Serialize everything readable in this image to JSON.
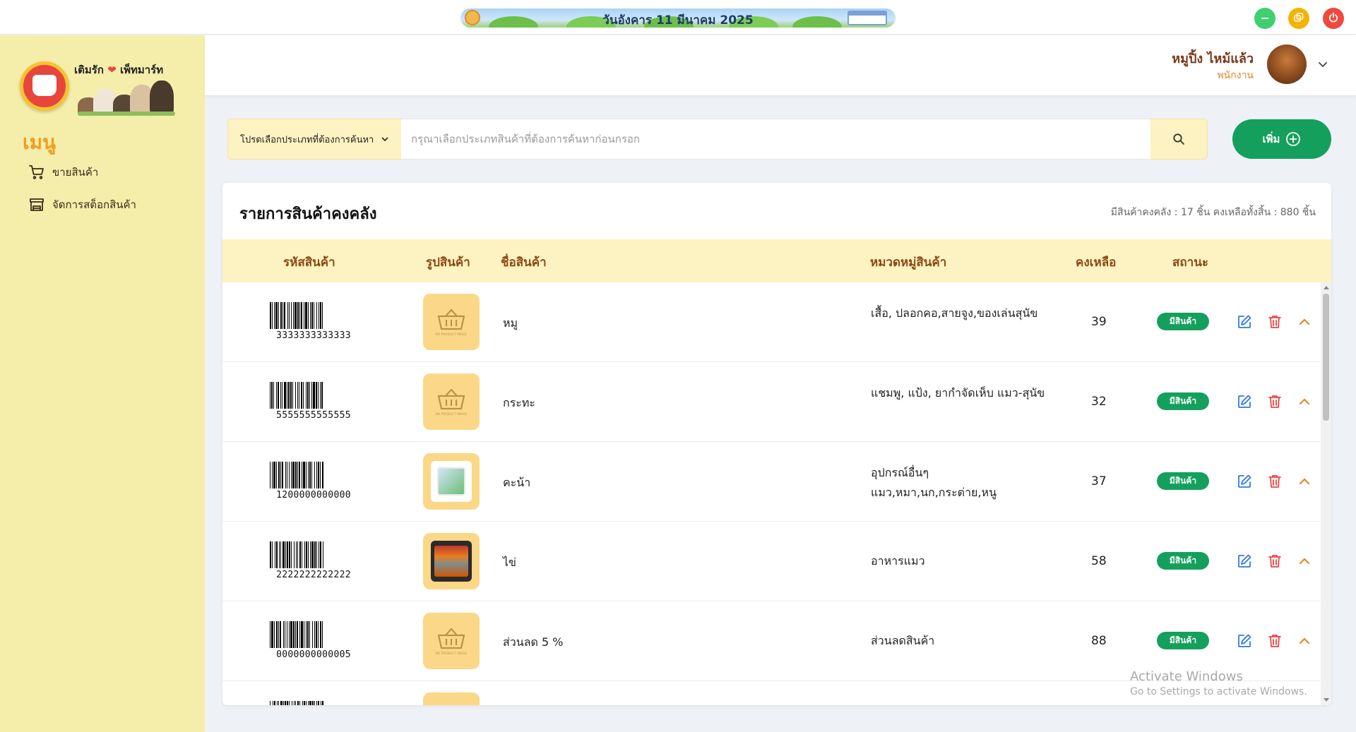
{
  "topbar": {
    "date_text": "วันอังคาร 11 มีนาคม 2025",
    "window_buttons": [
      "minimize-icon",
      "restore-icon",
      "power-icon"
    ],
    "colors": {
      "minimize": "#3ecf6e",
      "restore": "#f5b301",
      "close": "#f0473f"
    }
  },
  "sidebar": {
    "brand": {
      "left": "เติมรัก",
      "right": "เพ็ทมาร์ท"
    },
    "menu_title": "เมนู",
    "items": [
      {
        "label": "ขายสินค้า",
        "icon": "cart-icon"
      },
      {
        "label": "จัดการสต็อกสินค้า",
        "icon": "store-icon"
      }
    ],
    "colors": {
      "background": "#f4eeaa",
      "menu_title": "#f29c1f"
    }
  },
  "header": {
    "user_name": "หมูปิ้ง ไหม้แล้ว",
    "user_role": "พนักงาน"
  },
  "search": {
    "category_label": "โปรดเลือกประเภทที่ต้องการค้นหา",
    "placeholder": "กรุณาเลือกประเภทสินค้าที่ต้องการค้นหาก่อนกรอก",
    "value": ""
  },
  "add_button": {
    "label": "เพิ่ม",
    "color": "#14a05c"
  },
  "inventory": {
    "title": "รายการสินค้าคงคลัง",
    "summary": "มีสินค้าคงคลัง : 17 ชิ้น   คงเหลือทั้งสิ้น : 880 ชิ้น",
    "columns": [
      "รหัสสินค้า",
      "รูปสินค้า",
      "ชื่อสินค้า",
      "หมวดหมู่สินค้า",
      "คงเหลือ",
      "สถานะ"
    ],
    "rows": [
      {
        "code": "3333333333333",
        "image": "no-product-image",
        "name": "หมู",
        "category": "เสื้อ, ปลอกคอ,สายจูง,ของเล่นสุนัข",
        "stock": "39",
        "status": "มีสินค้า"
      },
      {
        "code": "5555555555555",
        "image": "no-product-image",
        "name": "กระทะ",
        "category": "แชมพู, แป้ง, ยากำจัดเห็บ แมว-สุนัข",
        "stock": "32",
        "status": "มีสินค้า"
      },
      {
        "code": "1200000000000",
        "image": "product-photo",
        "name": "คะน้า",
        "category": "อุปกรณ์อื่นๆ แมว,หมา,นก,กระต่าย,หนู",
        "stock": "37",
        "status": "มีสินค้า"
      },
      {
        "code": "2222222222222",
        "image": "product-photo",
        "name": "ไข่",
        "category": "อาหารแมว",
        "stock": "58",
        "status": "มีสินค้า"
      },
      {
        "code": "0000000000005",
        "image": "no-product-image",
        "name": "ส่วนลด 5 %",
        "category": "ส่วนลดสินค้า",
        "stock": "88",
        "status": "มีสินค้า"
      }
    ],
    "status_color": "#14a05c",
    "header_bg": "#fdf2c2"
  },
  "watermark": {
    "line1": "Activate Windows",
    "line2": "Go to Settings to activate Windows."
  }
}
